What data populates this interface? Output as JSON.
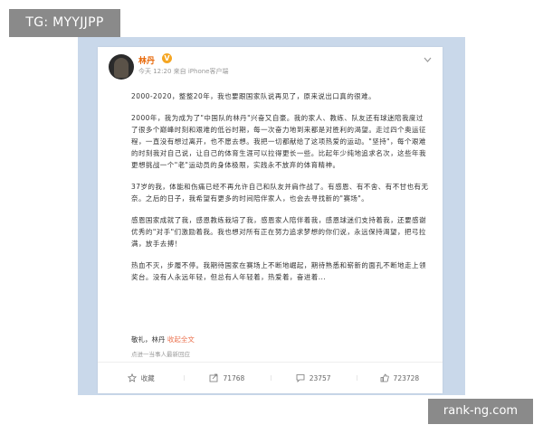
{
  "tag_label": "TG: MYYJJPP",
  "watermark": "rank-ng.com",
  "post": {
    "author": "林丹",
    "vip_badge": "V",
    "meta": "今天 12:20 来自 iPhone客户端",
    "paragraphs": [
      "2000-2020，整整20年，我也要跟国家队说再见了，原来说出口真的很难。",
      "2000年，我为成为了\"中国队的林丹\"兴奋又自豪。我的家人、教练、队友还有球迷陪我度过了很多个巅峰时刻和艰难的低谷时期，每一次奋力地到来都是对胜利的渴望。走过四个奥运征程，一直没有想过离开，也不愿去想。我把一切都献给了这项热爱的运动。\"坚持\"，每个艰难的时刻我对自己说，让自己的体育生涯可以拉得更长一些。比起年少纯地追求名次，这些年我更想挑战一个\"老\"运动员的身体极限，实践永不放弃的体育精神。",
      "37岁的我，体能和伤痛已经不再允许自己和队友并肩作战了。有感恩、有不舍、有不甘也有无奈。之后的日子，我希望有更多的时间陪伴家人，也会去寻找新的\"赛场\"。",
      "感恩国家成就了我，感恩教练栽培了我，感恩家人陪伴着我，感恩球迷们支持着我，还要感谢优秀的\"对手\"们激励着我。我也想对所有正在努力追求梦想的你们说，永远保持渴望，把弓拉满，放手去搏！",
      "热血不灭，步履不停。我期待国家在赛场上不断地崛起，期待熟悉和崭新的面孔不断地走上领奖台。没有人永远年轻，但总有人年轻着，热爱着，奋进着..."
    ],
    "signoff": "敬礼，林丹",
    "expand_link": "收起全文",
    "note": "点进一当事人最新回应",
    "actions": [
      {
        "icon": "star-icon",
        "label": "收藏"
      },
      {
        "icon": "share-icon",
        "label": "71768"
      },
      {
        "icon": "comment-icon",
        "label": "23757"
      },
      {
        "icon": "like-icon",
        "label": "723728"
      }
    ]
  }
}
